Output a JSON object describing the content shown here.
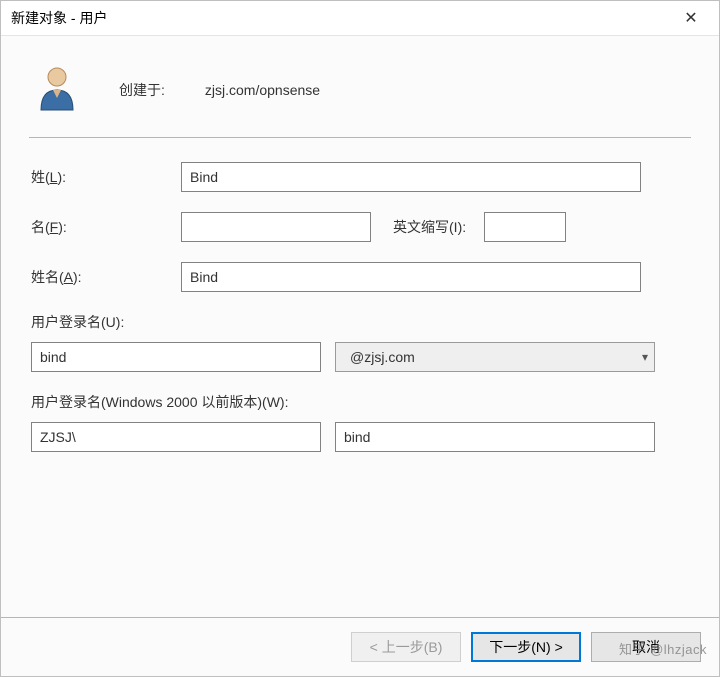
{
  "window": {
    "title": "新建对象 - 用户",
    "close_glyph": "✕"
  },
  "header": {
    "created_in_label": "创建于:",
    "created_in_path": "zjsj.com/opnsense"
  },
  "form": {
    "surname": {
      "label_prefix": "姓(",
      "hotkey": "L",
      "label_suffix": "):",
      "value": "Bind"
    },
    "given": {
      "label_prefix": "名(",
      "hotkey": "F",
      "label_suffix": "):",
      "value": ""
    },
    "initials": {
      "label_prefix": "英文缩写(",
      "hotkey": "I",
      "label_suffix": "):",
      "value": ""
    },
    "fullname": {
      "label_prefix": "姓名(",
      "hotkey": "A",
      "label_suffix": "):",
      "value": "Bind"
    },
    "login": {
      "label_prefix": "用户登录名(",
      "hotkey": "U",
      "label_suffix": "):",
      "value": "bind"
    },
    "domain_select": {
      "value": "@zjsj.com"
    },
    "legacy": {
      "label_prefix": "用户登录名(Windows 2000 以前版本)(",
      "hotkey": "W",
      "label_suffix": "):"
    },
    "domain_prefix": {
      "value": "ZJSJ\\"
    },
    "sam": {
      "value": "bind"
    }
  },
  "footer": {
    "back": {
      "prefix": "< 上一步(",
      "hotkey": "B",
      "suffix": ")"
    },
    "next": {
      "prefix": "下一步(",
      "hotkey": "N",
      "suffix": ") >"
    },
    "cancel": {
      "label": "取消"
    }
  },
  "watermark": "知乎 @lhzjack"
}
